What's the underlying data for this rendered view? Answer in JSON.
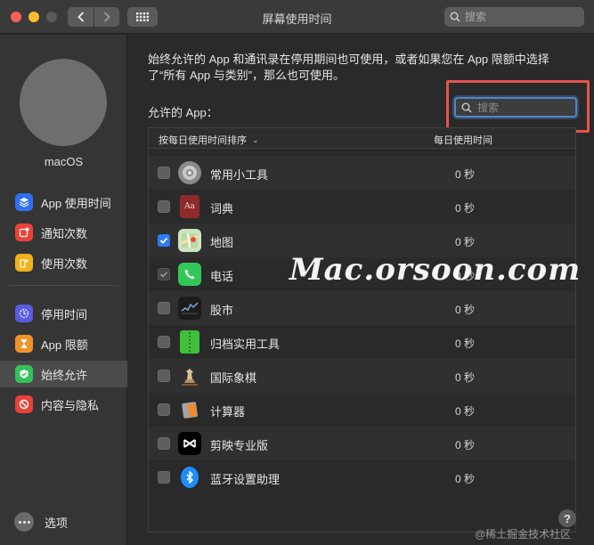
{
  "window": {
    "title": "屏幕使用时间"
  },
  "toolbar": {
    "search_placeholder": "搜索"
  },
  "sidebar": {
    "username": "macOS",
    "items": [
      {
        "label": "App 使用时间",
        "icon": "layers-icon",
        "color": "#2f6ff0"
      },
      {
        "label": "通知次数",
        "icon": "notification-icon",
        "color": "#e8423a"
      },
      {
        "label": "使用次数",
        "icon": "pickup-icon",
        "color": "#f1b11c"
      },
      {
        "label": "停用时间",
        "icon": "downtime-icon",
        "color": "#5b5be0"
      },
      {
        "label": "App 限额",
        "icon": "hourglass-icon",
        "color": "#f0932a"
      },
      {
        "label": "始终允许",
        "icon": "checkmark-shield-icon",
        "color": "#35c25a"
      },
      {
        "label": "内容与隐私",
        "icon": "restriction-icon",
        "color": "#e8423a"
      }
    ],
    "active_index": 5,
    "options_label": "选项"
  },
  "main": {
    "description": "始终允许的 App 和通讯录在停用期间也可使用，或者如果您在 App 限额中选择了“所有 App 与类别”，那么也可使用。",
    "allowed_label": "允许的 App：",
    "search_placeholder": "搜索",
    "table": {
      "sort_header": "按每日使用时间排序",
      "daily_header": "每日使用时间",
      "rows": [
        {
          "name": "常用小工具",
          "time": "0 秒",
          "checked": false,
          "disabled": false,
          "icon": "widgets-icon"
        },
        {
          "name": "词典",
          "time": "0 秒",
          "checked": false,
          "disabled": false,
          "icon": "dictionary-icon"
        },
        {
          "name": "地图",
          "time": "0 秒",
          "checked": true,
          "disabled": false,
          "icon": "maps-icon"
        },
        {
          "name": "电话",
          "time": "0 秒",
          "checked": true,
          "disabled": true,
          "icon": "phone-icon"
        },
        {
          "name": "股市",
          "time": "0 秒",
          "checked": false,
          "disabled": false,
          "icon": "stocks-icon"
        },
        {
          "name": "归档实用工具",
          "time": "0 秒",
          "checked": false,
          "disabled": false,
          "icon": "archive-utility-icon"
        },
        {
          "name": "国际象棋",
          "time": "0 秒",
          "checked": false,
          "disabled": false,
          "icon": "chess-icon"
        },
        {
          "name": "计算器",
          "time": "0 秒",
          "checked": false,
          "disabled": false,
          "icon": "calculator-icon"
        },
        {
          "name": "剪映专业版",
          "time": "0 秒",
          "checked": false,
          "disabled": false,
          "icon": "capcut-icon"
        },
        {
          "name": "蓝牙设置助理",
          "time": "0 秒",
          "checked": false,
          "disabled": false,
          "icon": "bluetooth-icon"
        }
      ]
    }
  },
  "overlay": {
    "watermark": "Mac.orsoon.com",
    "footer": "@稀土掘金技术社区",
    "help": "?"
  }
}
